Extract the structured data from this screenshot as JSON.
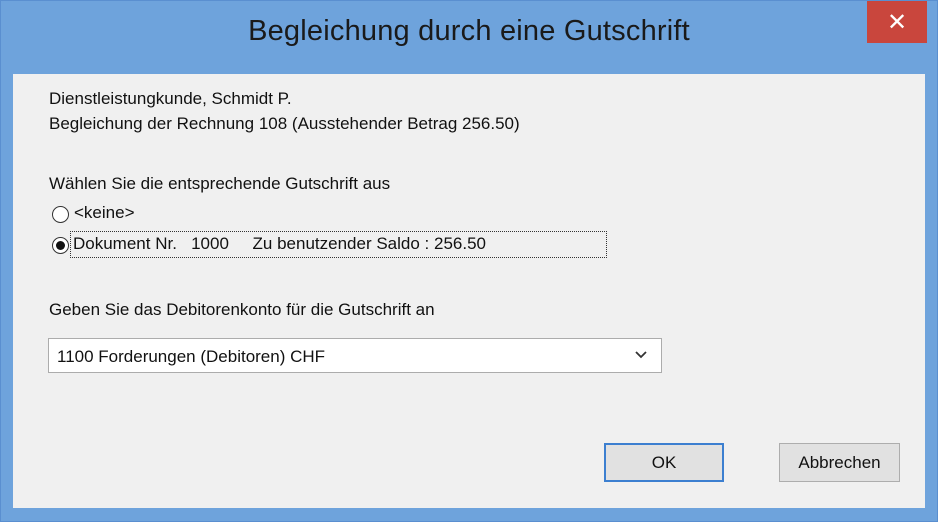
{
  "window": {
    "title": "Begleichung durch eine Gutschrift",
    "close_label": "✕"
  },
  "info": {
    "customer": "Dienstleistungkunde, Schmidt P.",
    "invoice": "Begleichung der Rechnung 108 (Ausstehender Betrag 256.50)"
  },
  "credit_selection": {
    "prompt": "Wählen Sie die entsprechende Gutschrift aus",
    "options": [
      {
        "label": "<keine>",
        "selected": false
      },
      {
        "label": "Dokument Nr.   1000     Zu benutzender Saldo : 256.50",
        "selected": true
      }
    ]
  },
  "account": {
    "prompt": "Geben Sie das Debitorenkonto für die Gutschrift an",
    "selected": "1100 Forderungen (Debitoren) CHF"
  },
  "buttons": {
    "ok": "OK",
    "cancel": "Abbrechen"
  },
  "colors": {
    "titlebar": "#6ea3dc",
    "close_button": "#c9463d",
    "dialog_background": "#f0f0f0",
    "default_button_border": "#3c7fd0"
  },
  "icons": {
    "close": "close-icon",
    "dropdown": "chevron-down-icon"
  }
}
